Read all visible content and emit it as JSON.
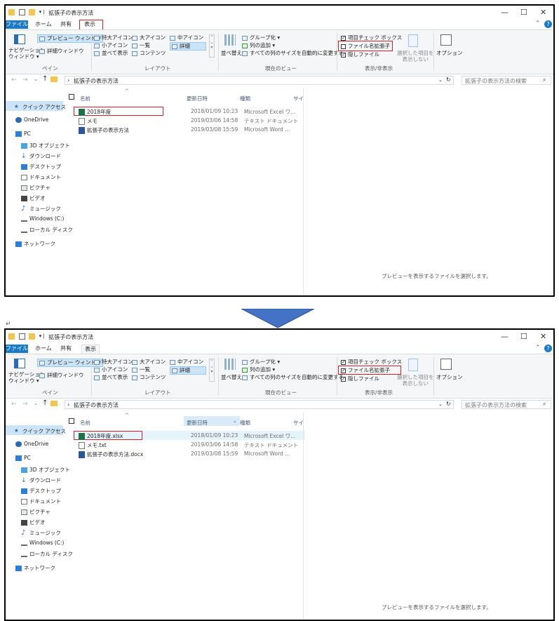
{
  "window_title": "拡張子の表示方法",
  "window_controls": {
    "minimize": "—",
    "maximize": "☐",
    "close": "✕"
  },
  "tabs": [
    {
      "label": "ファイル"
    },
    {
      "label": "ホーム"
    },
    {
      "label": "共有"
    },
    {
      "label": "表示"
    }
  ],
  "ribbon": {
    "pane": {
      "nav_pane": "ナビゲーション\nウィンドウ ▾",
      "preview": "プレビュー ウィンドウ",
      "details": "詳細ウィンドウ",
      "group": "ペイン"
    },
    "layout": {
      "items": [
        "特大アイコン",
        "大アイコン",
        "中アイコン",
        "小アイコン",
        "一覧",
        "詳細",
        "並べて表示",
        "コンテンツ"
      ],
      "group": "レイアウト"
    },
    "current_view": {
      "sort": "並べ替え",
      "group_by": "グループ化 ▾",
      "add_columns": "列の追加 ▾",
      "fit_columns": "すべての列のサイズを自動的に変更する",
      "group": "現在のビュー"
    },
    "show_hide": {
      "item_checkbox": "項目チェック ボックス",
      "file_ext": "ファイル名拡張子",
      "hidden": "隠しファイル",
      "hide_selected": "選択した項目を\n表示しない",
      "group": "表示/非表示"
    },
    "options": "オプション"
  },
  "address": {
    "path": "拡張子の表示方法",
    "search_placeholder": "拡張子の表示方法の検索"
  },
  "nav_items": [
    {
      "label": "クイック アクセス",
      "icon": "star-icon"
    },
    {
      "label": "OneDrive",
      "icon": "cloud-icon"
    },
    {
      "label": "PC",
      "icon": "pc-icon"
    },
    {
      "label": "3D オブジェクト",
      "icon": "cube-icon"
    },
    {
      "label": "ダウンロード",
      "icon": "download-icon"
    },
    {
      "label": "デスクトップ",
      "icon": "desktop-icon"
    },
    {
      "label": "ドキュメント",
      "icon": "document-icon"
    },
    {
      "label": "ピクチャ",
      "icon": "picture-icon"
    },
    {
      "label": "ビデオ",
      "icon": "video-icon"
    },
    {
      "label": "ミュージック",
      "icon": "music-icon"
    },
    {
      "label": "Windows (C:)",
      "icon": "drive-icon"
    },
    {
      "label": "ローカル ディスク",
      "icon": "disk-icon"
    },
    {
      "label": "ネットワーク",
      "icon": "network-icon"
    }
  ],
  "columns": {
    "name": "名前",
    "date": "更新日時",
    "type": "種類",
    "size": "サイ"
  },
  "preview_text": "プレビューを表示するファイルを選択します。",
  "before": {
    "file_ext_checked": false,
    "files": [
      {
        "name": "2018年度",
        "date": "2018/01/09 10:23",
        "type": "Microsoft Excel ワ...",
        "icon": "excel-icon"
      },
      {
        "name": "メモ",
        "date": "2019/03/06 14:58",
        "type": "テキスト ドキュメント",
        "icon": "text-file-icon"
      },
      {
        "name": "拡張子の表示方法",
        "date": "2019/03/08 15:59",
        "type": "Microsoft Word ...",
        "icon": "word-icon"
      }
    ]
  },
  "after": {
    "file_ext_checked": true,
    "files": [
      {
        "name": "2018年度.xlsx",
        "date": "2018/01/09 10:23",
        "type": "Microsoft Excel ワ...",
        "icon": "excel-icon"
      },
      {
        "name": "メモ.txt",
        "date": "2019/03/06 14:58",
        "type": "テキスト ドキュメント",
        "icon": "text-file-icon"
      },
      {
        "name": "拡張子の表示方法.docx",
        "date": "2019/03/08 15:59",
        "type": "Microsoft Word ...",
        "icon": "word-icon"
      }
    ]
  },
  "return_mark": "↵",
  "colors": {
    "accent": "#1979ca",
    "highlight": "#d21f2a",
    "arrow": "#4472c4"
  }
}
